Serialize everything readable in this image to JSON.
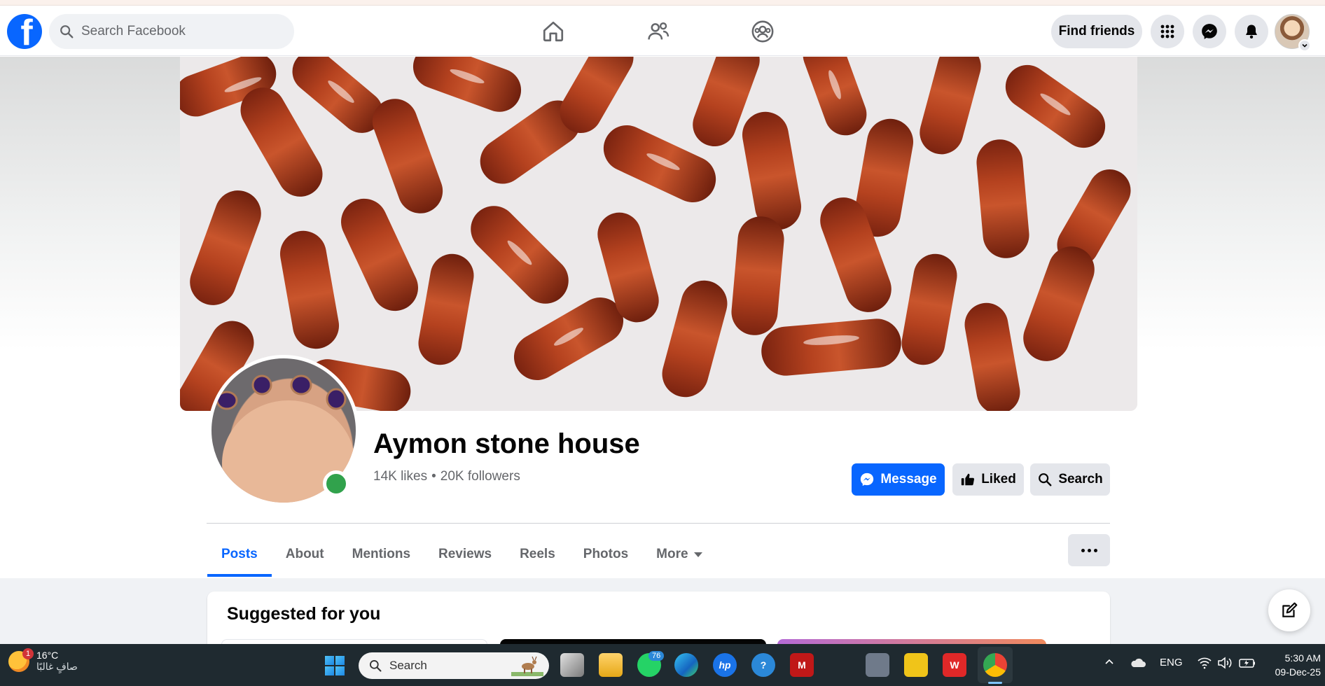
{
  "header": {
    "logo_letter": "f",
    "search_placeholder": "Search Facebook",
    "find_friends": "Find friends"
  },
  "profile": {
    "name": "Aymon stone house",
    "likes": "14K likes",
    "separator": "•",
    "followers": "20K followers",
    "buttons": {
      "message": "Message",
      "liked": "Liked",
      "search": "Search"
    }
  },
  "tabs": [
    "Posts",
    "About",
    "Mentions",
    "Reviews",
    "Reels",
    "Photos",
    "More"
  ],
  "active_tab": "Posts",
  "feed": {
    "suggested_title": "Suggested for you"
  },
  "taskbar": {
    "weather_temp": "16°C",
    "weather_desc": "صافٍ غالبًا",
    "weather_badge": "1",
    "search_placeholder": "Search",
    "whatsapp_badge": "76",
    "language": "ENG",
    "time": "5:30 AM",
    "date": "09-Dec-25"
  },
  "colors": {
    "brand_blue": "#0866ff",
    "online_green": "#31a24c",
    "taskbar": "#1f2a30"
  }
}
